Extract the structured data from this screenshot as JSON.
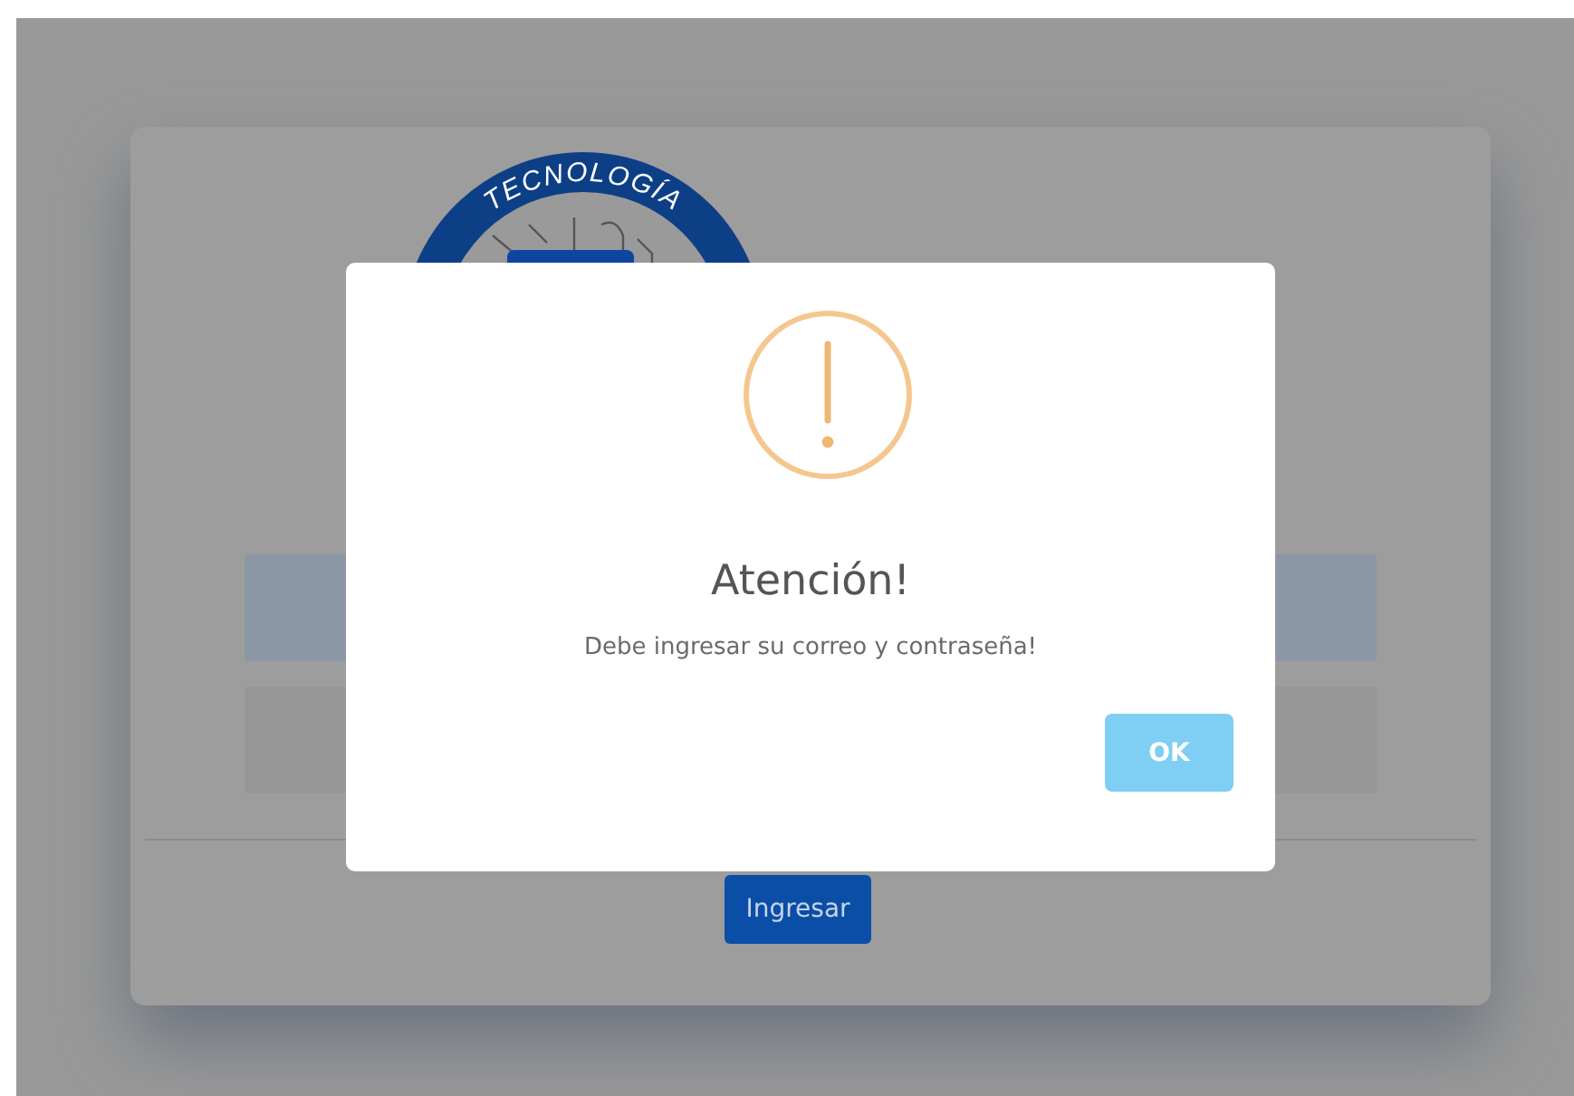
{
  "logo": {
    "text": "TECNOLOGÍA"
  },
  "login_form": {
    "fields": [
      {
        "focused": true
      },
      {
        "focused": false
      }
    ],
    "submit_button": "Ingresar"
  },
  "dialog": {
    "title": "Atención!",
    "message": "Debe ingresar su correo y contraseña!",
    "confirm_button": "OK"
  }
}
